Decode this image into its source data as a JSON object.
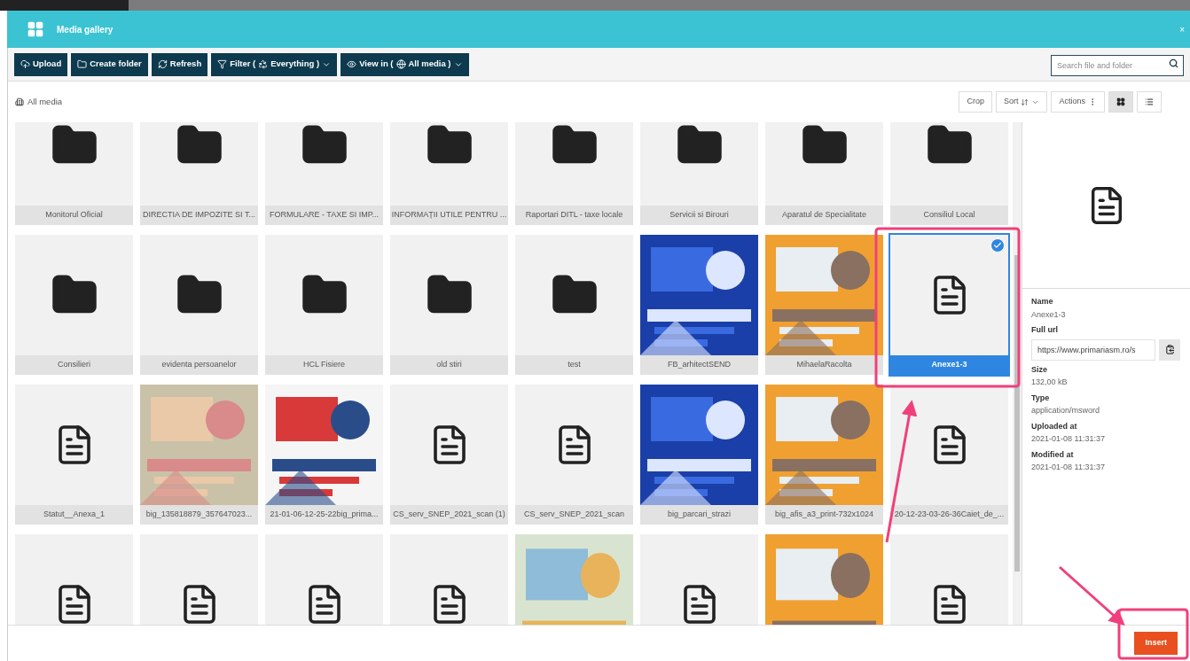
{
  "dialog": {
    "title": "Media gallery",
    "close": "×"
  },
  "toolbar": {
    "buttons": [
      {
        "kind": "upload",
        "label": "Upload"
      },
      {
        "kind": "folder",
        "label": "Create folder"
      },
      {
        "kind": "refresh",
        "label": "Refresh"
      },
      {
        "kind": "filter",
        "label": "Filter (",
        "value": "Everything )"
      },
      {
        "kind": "view",
        "label": "View in (",
        "value": "All media )"
      }
    ],
    "search": {
      "placeholder": "Search file and folder"
    }
  },
  "breadcrumb": "All media",
  "actions": [
    {
      "kind": "plain",
      "label": "Crop"
    },
    {
      "kind": "sort",
      "label": "Sort"
    },
    {
      "kind": "menu",
      "label": "Actions"
    }
  ],
  "view_modes": [
    {
      "kind": "grid",
      "selected": true
    },
    {
      "kind": "list",
      "selected": false
    }
  ],
  "items": [
    {
      "kind": "folder",
      "label": "Monitorul Oficial",
      "selected": false
    },
    {
      "kind": "folder",
      "label": "DIRECTIA DE IMPOZITE SI T...",
      "selected": false
    },
    {
      "kind": "folder",
      "label": "FORMULARE - TAXE SI IMP...",
      "selected": false
    },
    {
      "kind": "folder",
      "label": "INFORMAȚII UTILE PENTRU ...",
      "selected": false
    },
    {
      "kind": "folder",
      "label": "Raportari DITL - taxe locale",
      "selected": false
    },
    {
      "kind": "folder",
      "label": "Servicii si Birouri",
      "selected": false
    },
    {
      "kind": "folder",
      "label": "Aparatul de Specialitate",
      "selected": false
    },
    {
      "kind": "folder",
      "label": "Consiliul Local",
      "selected": false
    },
    {
      "kind": "folder",
      "label": "Consilieri",
      "selected": false
    },
    {
      "kind": "folder",
      "label": "evidenta persoanelor",
      "selected": false
    },
    {
      "kind": "folder",
      "label": "HCL Fisiere",
      "selected": false
    },
    {
      "kind": "folder",
      "label": "old stiri",
      "selected": false
    },
    {
      "kind": "folder",
      "label": "test",
      "selected": false
    },
    {
      "kind": "picture",
      "label": "FB_arhitectSEND",
      "selected": false
    },
    {
      "kind": "picture",
      "label": "MihaelaRacolta",
      "selected": false
    },
    {
      "kind": "document",
      "label": "Anexe1-3",
      "selected": true
    },
    {
      "kind": "document",
      "label": "Statut__Anexa_1",
      "selected": false
    },
    {
      "kind": "picture",
      "label": "big_135818879_357647023...",
      "selected": false
    },
    {
      "kind": "picture",
      "label": "21-01-06-12-25-22big_prima...",
      "selected": false
    },
    {
      "kind": "document",
      "label": "CS_serv_SNEP_2021_scan (1)",
      "selected": false
    },
    {
      "kind": "document",
      "label": "CS_serv_SNEP_2021_scan",
      "selected": false
    },
    {
      "kind": "picture",
      "label": "big_parcari_strazi",
      "selected": false
    },
    {
      "kind": "picture",
      "label": "big_afis_a3_print-732x1024",
      "selected": false
    },
    {
      "kind": "document",
      "label": "20-12-23-03-26-36Caiet_de_...",
      "selected": false
    },
    {
      "kind": "document",
      "selected": false
    },
    {
      "kind": "document",
      "selected": false
    },
    {
      "kind": "document",
      "selected": false
    },
    {
      "kind": "document",
      "selected": false
    },
    {
      "kind": "picture",
      "selected": false
    },
    {
      "kind": "document",
      "selected": false
    },
    {
      "kind": "picture",
      "selected": false
    },
    {
      "kind": "document",
      "selected": false
    }
  ],
  "details": {
    "fields": [
      {
        "kind": "text",
        "label": "Name",
        "value": "Anexe1-3"
      },
      {
        "kind": "url",
        "label": "Full url",
        "value": "https://www.primariasm.ro/s"
      },
      {
        "kind": "text",
        "label": "Size",
        "value": "132,00 kB"
      },
      {
        "kind": "text",
        "label": "Type",
        "value": "application/msword"
      },
      {
        "kind": "text",
        "label": "Uploaded at",
        "value": "2021-01-08 11:31:37"
      },
      {
        "kind": "text",
        "label": "Modified at",
        "value": "2021-01-08 11:31:37"
      }
    ]
  },
  "footer": {
    "insert": "Insert"
  }
}
